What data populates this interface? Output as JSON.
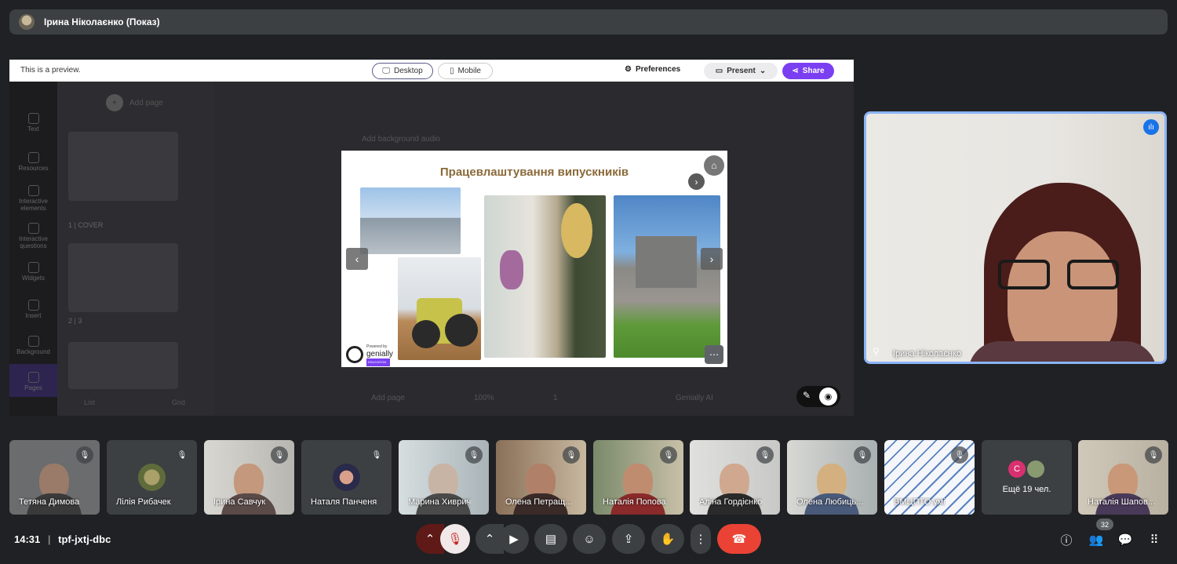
{
  "presenter_bar": {
    "title": "Ірина Ніколаєнко (Показ)"
  },
  "genially": {
    "preview_text": "This is a preview.",
    "desktop_label": "Desktop",
    "mobile_label": "Mobile",
    "preferences_label": "Preferences",
    "present_label": "Present",
    "share_label": "Share",
    "sidebar_tools": [
      "Text",
      "Resources",
      "Interactive elements",
      "Interactive questions",
      "Widgets",
      "Insert",
      "Background",
      "Pages"
    ],
    "add_page_label": "Add page",
    "page_labels": [
      "1 | COVER",
      "2 | 3"
    ],
    "list_label": "List",
    "grid_label": "Grid",
    "add_bg_audio": "Add background audio",
    "bottom_add_page": "Add page",
    "zoom": "100%",
    "page_number": "1",
    "ai_label": "Genially AI"
  },
  "slide": {
    "title": "Працевлаштування випускників",
    "powered_by": "Powered by",
    "brand": "genially",
    "brand_tag": "EDUCATION"
  },
  "speaker": {
    "name": "Ірина Ніколаєнко"
  },
  "participants": [
    {
      "name": "Тетяна Димова"
    },
    {
      "name": "Лілія Рибачек"
    },
    {
      "name": "Ірина Савчук"
    },
    {
      "name": "Наталя Панченя"
    },
    {
      "name": "Марина Хиврич"
    },
    {
      "name": "Олена Петращ..."
    },
    {
      "name": "Наталія Попова"
    },
    {
      "name": "Аліна Гордієнко"
    },
    {
      "name": "Олена Любиць..."
    },
    {
      "name": "ВМЦПТО умі"
    },
    {
      "name": "Ещё 19 чел.",
      "initial": "С"
    },
    {
      "name": "Наталія Шапов..."
    }
  ],
  "meeting": {
    "time": "14:31",
    "code": "tpf-jxtj-dbc",
    "people_count": "32"
  },
  "colors": {
    "accent": "#8ab4f8",
    "share_purple": "#7b3ff2",
    "end_call": "#ea4335",
    "background": "#202124"
  }
}
